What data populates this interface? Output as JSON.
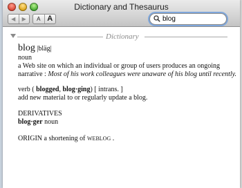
{
  "window": {
    "title": "Dictionary and Thesaurus"
  },
  "toolbar": {
    "back_label": "◀",
    "forward_label": "▶",
    "font_small_label": "A",
    "font_large_label": "A"
  },
  "search": {
    "query": "blog"
  },
  "section": {
    "title": "Dictionary"
  },
  "entry": {
    "headword": "blog",
    "pronunciation": "|bläg|",
    "pos_noun": "noun",
    "definition_noun": "a Web site on which an individual or group of users produces an ongoing narrative :",
    "example_noun": "Most of his work colleagues were unaware of his blog until recently.",
    "verb_label": "verb (",
    "verb_form1": "blogged",
    "verb_sep": ",",
    "verb_form2": "blog·ging",
    "verb_tail": ") [ intrans. ]",
    "definition_verb": "add new material to or regularly update a blog.",
    "derivatives_label": "DERIVATIVES",
    "derivative_word": "blog·ger",
    "derivative_pos": "noun",
    "origin_label": "ORIGIN",
    "origin_text": "a shortening of",
    "origin_word": "weblog",
    "origin_end": "."
  }
}
